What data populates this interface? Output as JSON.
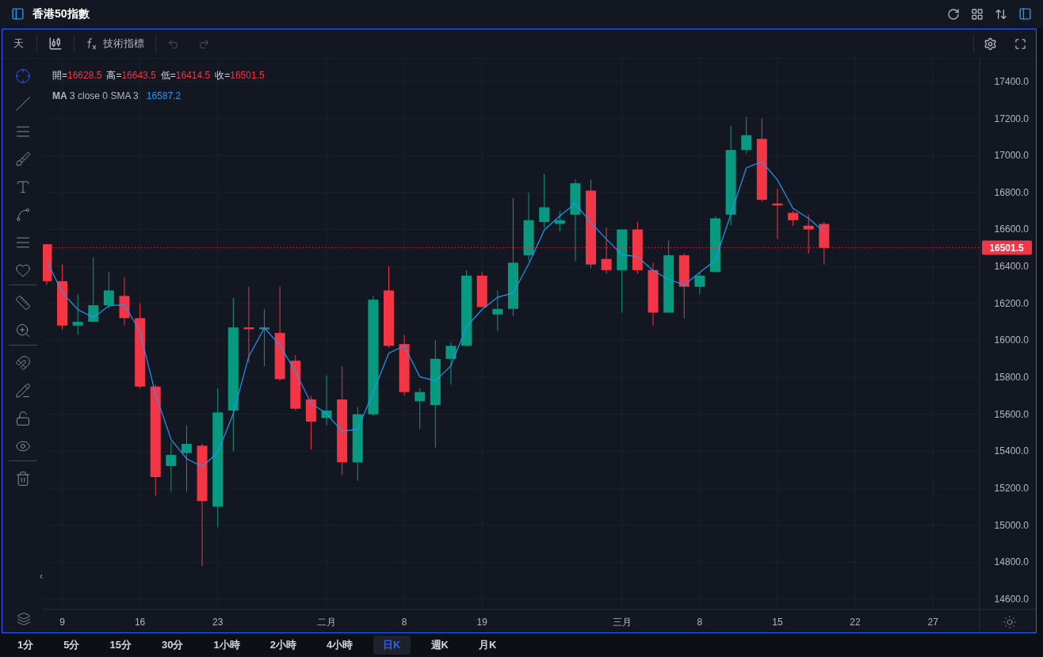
{
  "window": {
    "title": "香港50指數"
  },
  "toolbar": {
    "interval": "天",
    "indicators": "技術指標"
  },
  "legend": {
    "ohlc": [
      {
        "label": "開=",
        "value": "16628.5"
      },
      {
        "label": "高=",
        "value": "16643.5"
      },
      {
        "label": "低=",
        "value": "16414.5"
      },
      {
        "label": "收=",
        "value": "16501.5"
      }
    ],
    "study": {
      "params": "3 close 0 SMA 3",
      "value": "16587.2"
    }
  },
  "collapse_toggle": "‹",
  "chart_data": {
    "type": "candlestick",
    "grid": true,
    "ylim": [
      14544,
      17524
    ],
    "ref_lines": [
      {
        "axis": "y",
        "value": 16501.5,
        "label": "16501.5",
        "color": "#f23645"
      }
    ],
    "yticks": [
      {
        "value": 14600,
        "label": "14600.0"
      },
      {
        "value": 14800,
        "label": "14800.0"
      },
      {
        "value": 15000,
        "label": "15000.0"
      },
      {
        "value": 15200,
        "label": "15200.0"
      },
      {
        "value": 15400,
        "label": "15400.0"
      },
      {
        "value": 15600,
        "label": "15600.0"
      },
      {
        "value": 15800,
        "label": "15800.0"
      },
      {
        "value": 16000,
        "label": "16000.0"
      },
      {
        "value": 16200,
        "label": "16200.0"
      },
      {
        "value": 16400,
        "label": "16400.0"
      },
      {
        "value": 16600,
        "label": "16600.0"
      },
      {
        "value": 16800,
        "label": "16800.0"
      },
      {
        "value": 17000,
        "label": "17000.0"
      },
      {
        "value": 17200,
        "label": "17200.0"
      },
      {
        "value": 17400,
        "label": "17400.0"
      }
    ],
    "categories": [
      null,
      "9",
      null,
      null,
      null,
      null,
      "16",
      null,
      null,
      null,
      null,
      "23",
      null,
      null,
      null,
      null,
      null,
      null,
      "二月",
      null,
      null,
      null,
      null,
      "8",
      null,
      null,
      null,
      null,
      "19",
      null,
      null,
      null,
      null,
      null,
      null,
      null,
      null,
      "三月",
      null,
      null,
      null,
      null,
      "8",
      null,
      null,
      null,
      null,
      "15",
      null,
      null,
      null,
      null,
      "22",
      null,
      null,
      null,
      null,
      "27",
      null,
      null
    ],
    "ohlc": [
      [
        16520,
        16520,
        16300,
        16320
      ],
      [
        16320,
        16410,
        16060,
        16080
      ],
      [
        16080,
        16250,
        16030,
        16100
      ],
      [
        16100,
        16450,
        16100,
        16190
      ],
      [
        16190,
        16370,
        16170,
        16270
      ],
      [
        16240,
        16340,
        16080,
        16120
      ],
      [
        16120,
        16200,
        15740,
        15750
      ],
      [
        15750,
        15760,
        15160,
        15260
      ],
      [
        15320,
        15450,
        15180,
        15380
      ],
      [
        15390,
        15540,
        15180,
        15440
      ],
      [
        15430,
        15440,
        14780,
        15130
      ],
      [
        15100,
        15740,
        14990,
        15610
      ],
      [
        15620,
        16230,
        15400,
        16070
      ],
      [
        16070,
        16290,
        15880,
        16060
      ],
      [
        16060,
        16170,
        15860,
        16070
      ],
      [
        16040,
        16290,
        15780,
        15790
      ],
      [
        15890,
        15920,
        15620,
        15630
      ],
      [
        15680,
        15700,
        15410,
        15560
      ],
      [
        15580,
        15810,
        15540,
        15620
      ],
      [
        15680,
        15860,
        15270,
        15340
      ],
      [
        15340,
        15640,
        15240,
        15600
      ],
      [
        15600,
        16240,
        15590,
        16220
      ],
      [
        16270,
        16400,
        15960,
        15970
      ],
      [
        15980,
        16030,
        15700,
        15720
      ],
      [
        15670,
        15740,
        15520,
        15720
      ],
      [
        15650,
        16000,
        15420,
        15900
      ],
      [
        15900,
        15990,
        15760,
        15970
      ],
      [
        15970,
        16380,
        15970,
        16350
      ],
      [
        16350,
        16370,
        16180,
        16180
      ],
      [
        16140,
        16270,
        16050,
        16170
      ],
      [
        16170,
        16770,
        16130,
        16420
      ],
      [
        16460,
        16800,
        16430,
        16650
      ],
      [
        16640,
        16900,
        16610,
        16720
      ],
      [
        16630,
        16700,
        16590,
        16650
      ],
      [
        16680,
        16870,
        16430,
        16850
      ],
      [
        16810,
        16870,
        16390,
        16410
      ],
      [
        16440,
        16610,
        16360,
        16380
      ],
      [
        16380,
        16600,
        16150,
        16600
      ],
      [
        16600,
        16640,
        16360,
        16380
      ],
      [
        16380,
        16420,
        16080,
        16150
      ],
      [
        16150,
        16540,
        16150,
        16460
      ],
      [
        16460,
        16470,
        16120,
        16290
      ],
      [
        16290,
        16370,
        16250,
        16350
      ],
      [
        16370,
        16670,
        16370,
        16660
      ],
      [
        16680,
        17160,
        16620,
        17030
      ],
      [
        17030,
        17210,
        17010,
        17110
      ],
      [
        17090,
        17200,
        16750,
        16760
      ],
      [
        16740,
        16820,
        16550,
        16730
      ],
      [
        16690,
        16700,
        16620,
        16650
      ],
      [
        16620,
        16680,
        16470,
        16600
      ],
      [
        16630,
        16640,
        16410,
        16500
      ],
      null,
      null,
      null,
      null,
      null,
      null,
      null,
      null,
      null
    ],
    "series": [
      {
        "name": "MA",
        "type": "line",
        "color": "#2196f3",
        "values": [
          16430,
          16260,
          16167,
          16123,
          16187,
          16193,
          16047,
          15710,
          15463,
          15360,
          15317,
          15393,
          15603,
          15913,
          16067,
          15973,
          15830,
          15660,
          15603,
          15507,
          15520,
          15720,
          15930,
          15970,
          15803,
          15780,
          15863,
          16073,
          16167,
          16233,
          16257,
          16413,
          16597,
          16673,
          16740,
          16637,
          16547,
          16463,
          16453,
          16377,
          16330,
          16300,
          16367,
          16433,
          16680,
          16933,
          16967,
          16867,
          16713,
          16660,
          16587,
          null,
          null,
          null,
          null,
          null,
          null,
          null,
          null,
          null
        ]
      }
    ]
  },
  "timeframes": [
    {
      "label": "1分",
      "selected": false
    },
    {
      "label": "5分",
      "selected": false
    },
    {
      "label": "15分",
      "selected": false
    },
    {
      "label": "30分",
      "selected": false
    },
    {
      "label": "1小時",
      "selected": false
    },
    {
      "label": "2小時",
      "selected": false
    },
    {
      "label": "4小時",
      "selected": false
    },
    {
      "label": "日K",
      "selected": true
    },
    {
      "label": "週K",
      "selected": false
    },
    {
      "label": "月K",
      "selected": false
    }
  ]
}
